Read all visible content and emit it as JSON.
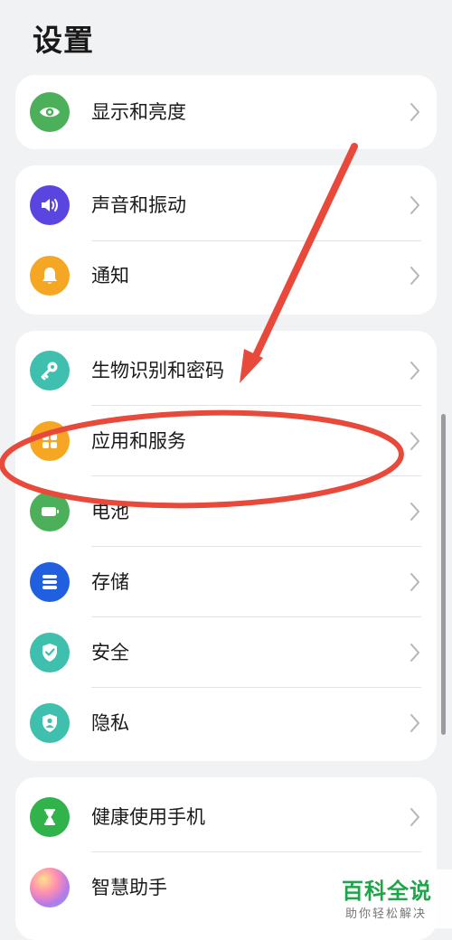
{
  "header": {
    "title": "设置"
  },
  "groups": [
    {
      "items": [
        {
          "label": "显示和亮度",
          "icon": "eye-icon",
          "color": "#4caf5a"
        }
      ]
    },
    {
      "items": [
        {
          "label": "声音和振动",
          "icon": "speaker-icon",
          "color": "#5b45e0"
        },
        {
          "label": "通知",
          "icon": "bell-icon",
          "color": "#f5a623"
        }
      ]
    },
    {
      "items": [
        {
          "label": "生物识别和密码",
          "icon": "key-icon",
          "color": "#3fbfae"
        },
        {
          "label": "应用和服务",
          "icon": "apps-grid-icon",
          "color": "#f5a623"
        },
        {
          "label": "电池",
          "icon": "battery-icon",
          "color": "#4caf5a"
        },
        {
          "label": "存储",
          "icon": "storage-icon",
          "color": "#1f5fe0"
        },
        {
          "label": "安全",
          "icon": "shield-check-icon",
          "color": "#3fbfae"
        },
        {
          "label": "隐私",
          "icon": "privacy-shield-icon",
          "color": "#3fbfae"
        }
      ]
    },
    {
      "items": [
        {
          "label": "健康使用手机",
          "icon": "hourglass-icon",
          "color": "#2fb34a"
        },
        {
          "label": "智慧助手",
          "icon": "assistant-orb-icon",
          "color": "#c07ae0"
        }
      ]
    }
  ],
  "annotation": {
    "color": "#e8493a"
  },
  "watermark": {
    "main": "百科全说",
    "sub": "助你轻松解决",
    "color": "#1fa44a"
  }
}
